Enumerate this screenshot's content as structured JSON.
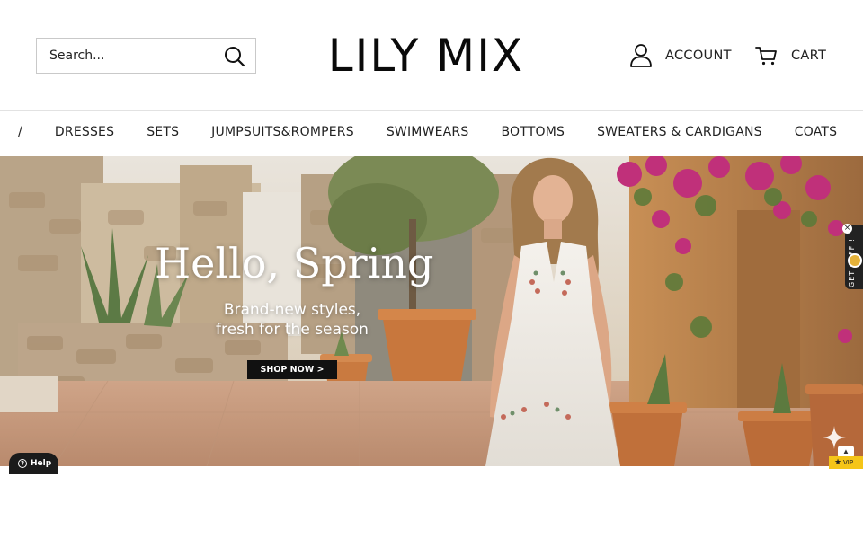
{
  "header": {
    "search_placeholder": "Search...",
    "logo": "LILY MIX",
    "account_label": "ACCOUNT",
    "cart_label": "CART"
  },
  "nav": {
    "separator": "/",
    "items": [
      "DRESSES",
      "SETS",
      "JUMPSUITS&ROMPERS",
      "SWIMWEARS",
      "BOTTOMS",
      "SWEATERS & CARDIGANS",
      "COATS"
    ]
  },
  "hero": {
    "title": "Hello, Spring",
    "subtitle_line1": "Brand-new styles,",
    "subtitle_line2": "fresh for the season",
    "cta_label": "SHOP NOW >"
  },
  "widgets": {
    "help_label": "Help",
    "side_tab_label": "GET $OFF !",
    "vip_label": "VIP"
  },
  "icons": {
    "search": "search-icon",
    "account": "user-icon",
    "cart": "cart-icon",
    "help": "question-icon",
    "sparkle": "sparkle-icon",
    "scroll_up": "chevron-up-icon",
    "vip": "star-icon"
  }
}
